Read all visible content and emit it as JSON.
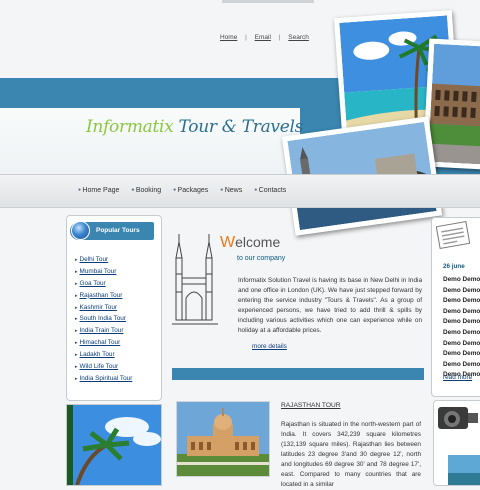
{
  "top_links": {
    "home": "Home",
    "email": "Email",
    "search": "Search",
    "separator": "|"
  },
  "brand": {
    "part1": "Informatix",
    "part2": " Tour & Travels"
  },
  "nav": {
    "items": [
      "Home Page",
      "Booking",
      "Packages",
      "News",
      "Contacts"
    ]
  },
  "popular_tours": {
    "title": "Popular Tours",
    "items": [
      "Delhi Tour",
      "Mumbai Tour",
      "Goa Tour",
      "Rajasthan Tour",
      "Kashmir Tour",
      "South India Tour",
      "India Train Tour",
      "Himachal Tour",
      "Ladakh Tour",
      "Wild Life Tour",
      "India Spiritual Tour"
    ]
  },
  "welcome": {
    "first_letter": "W",
    "rest": "elcome",
    "subtitle": "to our company",
    "body": "Informatix Solution Travel is having its base in New Delhi in India and one office in London (UK). We have just stepped forward by entering the service industry \"Tours & Travels\". As a group of experienced persons, we have tried to add thrill & spills by including various activities which one can experience while on holiday at a affordable prices.",
    "more": "more details"
  },
  "news": {
    "date": "26 june",
    "lines": [
      "Demo Demo Demo",
      "Demo Demo Demo",
      "Demo Demo Demo",
      "Demo Demo Demo",
      "Demo Demo Demo",
      "Demo DemoDemo",
      "Demo Demo Demo",
      "Demo Demo Demo",
      "Demo Demo Demo",
      "Demo Demo Demo"
    ],
    "read_more": "read more"
  },
  "rajasthan": {
    "title": "RAJASTHAN TOUR",
    "body": "Rajasthan is situated in the north-western part of India. It covers 342,239 square kilometres (132,139 square miles). Rajasthan lies between latitudes 23 degree 3'and 30 degree 12', north and longitudes 69 degree 30' and 78 degree 17', east. Compared to many countries that are located in a similar"
  },
  "colors": {
    "banner": "#3a86b0",
    "brand_green": "#8cc63f",
    "brand_blue": "#2b6f8f",
    "welcome_orange": "#e77b1a",
    "link": "#0c3d7a"
  }
}
